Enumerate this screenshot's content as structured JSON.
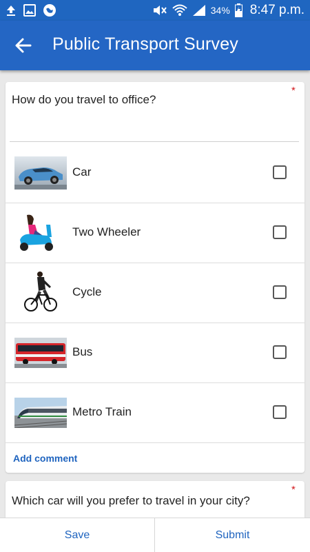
{
  "status_bar": {
    "battery_percent": "34%",
    "time": "8:47 p.m.",
    "icons": [
      "upload-icon",
      "image-icon",
      "globe-icon",
      "mute-icon",
      "wifi-icon",
      "signal-icon",
      "battery-charging-icon"
    ]
  },
  "app_bar": {
    "title": "Public Transport Survey",
    "back_icon": "arrow-left-icon"
  },
  "question1": {
    "text": "How do you travel to office?",
    "required_marker": "*",
    "options": [
      {
        "label": "Car",
        "checked": false,
        "image": "car-photo"
      },
      {
        "label": "Two Wheeler",
        "checked": false,
        "image": "scooter-photo"
      },
      {
        "label": "Cycle",
        "checked": false,
        "image": "bicycle-photo"
      },
      {
        "label": "Bus",
        "checked": false,
        "image": "bus-photo"
      },
      {
        "label": "Metro Train",
        "checked": false,
        "image": "metro-train-photo"
      }
    ],
    "add_comment": "Add comment"
  },
  "question2": {
    "text": "Which car will you prefer to travel in your city?",
    "required_marker": "*"
  },
  "bottom_bar": {
    "save_label": "Save",
    "submit_label": "Submit"
  },
  "colors": {
    "primary": "#2466c4",
    "status_bar": "#1f66c0",
    "link": "#1f64bf",
    "required": "#d2191d",
    "background": "#e9e9e9"
  }
}
